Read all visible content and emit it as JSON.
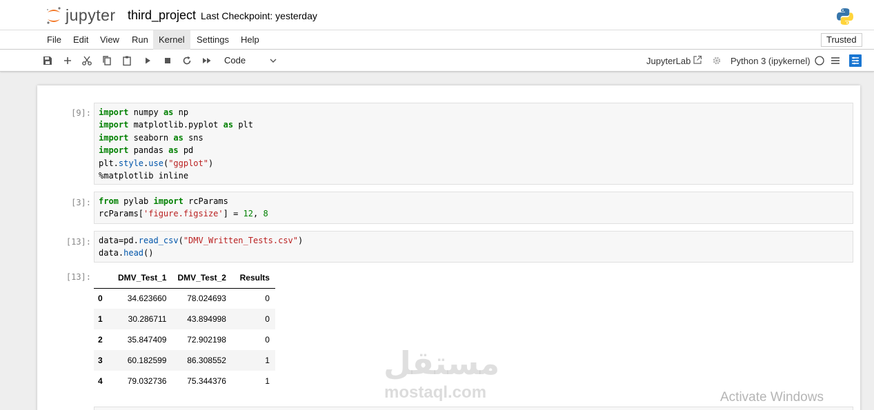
{
  "header": {
    "logo_text": "jupyter",
    "notebook_title": "third_project",
    "checkpoint": "Last Checkpoint: yesterday"
  },
  "menu": {
    "items": [
      "File",
      "Edit",
      "View",
      "Run",
      "Kernel",
      "Settings",
      "Help"
    ],
    "active": "Kernel",
    "trusted": "Trusted"
  },
  "toolbar": {
    "icons": [
      "save-icon",
      "add-cell-icon",
      "cut-icon",
      "copy-icon",
      "paste-icon",
      "run-icon",
      "stop-icon",
      "restart-icon",
      "fast-forward-icon"
    ],
    "cell_type": "Code",
    "jupyterlab_label": "JupyterLab",
    "kernel_name": "Python 3 (ipykernel)"
  },
  "cells": [
    {
      "prompt": "[9]:",
      "lines": [
        [
          [
            "k",
            "import"
          ],
          [
            "t",
            " numpy "
          ],
          [
            "k",
            "as"
          ],
          [
            "t",
            " np"
          ]
        ],
        [
          [
            "k",
            "import"
          ],
          [
            "t",
            " matplotlib.pyplot "
          ],
          [
            "k",
            "as"
          ],
          [
            "t",
            " plt"
          ]
        ],
        [
          [
            "k",
            "import"
          ],
          [
            "t",
            " seaborn "
          ],
          [
            "k",
            "as"
          ],
          [
            "t",
            " sns"
          ]
        ],
        [
          [
            "k",
            "import"
          ],
          [
            "t",
            " pandas "
          ],
          [
            "k",
            "as"
          ],
          [
            "t",
            " pd"
          ]
        ],
        [
          [
            "t",
            "plt."
          ],
          [
            "f",
            "style"
          ],
          [
            "t",
            "."
          ],
          [
            "f",
            "use"
          ],
          [
            "t",
            "("
          ],
          [
            "s",
            "\"ggplot\""
          ],
          [
            "t",
            ")"
          ]
        ],
        [
          [
            "t",
            "%matplotlib inline"
          ]
        ]
      ]
    },
    {
      "prompt": "[3]:",
      "lines": [
        [
          [
            "k",
            "from"
          ],
          [
            "t",
            " pylab "
          ],
          [
            "k",
            "import"
          ],
          [
            "t",
            " rcParams"
          ]
        ],
        [
          [
            "t",
            "rcParams["
          ],
          [
            "s",
            "'figure.figsize'"
          ],
          [
            "t",
            "] = "
          ],
          [
            "n",
            "12"
          ],
          [
            "t",
            ", "
          ],
          [
            "n",
            "8"
          ]
        ]
      ]
    },
    {
      "prompt": "[13]:",
      "lines": [
        [
          [
            "t",
            "data=pd."
          ],
          [
            "f",
            "read_csv"
          ],
          [
            "t",
            "("
          ],
          [
            "s",
            "\"DMV_Written_Tests.csv\""
          ],
          [
            "t",
            ")"
          ]
        ],
        [
          [
            "t",
            "data."
          ],
          [
            "f",
            "head"
          ],
          [
            "t",
            "()"
          ]
        ]
      ]
    }
  ],
  "output": {
    "prompt": "[13]:",
    "columns": [
      "",
      "DMV_Test_1",
      "DMV_Test_2",
      "Results"
    ],
    "rows": [
      [
        "0",
        "34.623660",
        "78.024693",
        "0"
      ],
      [
        "1",
        "30.286711",
        "43.894998",
        "0"
      ],
      [
        "2",
        "35.847409",
        "72.902198",
        "0"
      ],
      [
        "3",
        "60.182599",
        "86.308552",
        "1"
      ],
      [
        "4",
        "79.032736",
        "75.344376",
        "1"
      ]
    ]
  },
  "watermark": {
    "arabic": "مستقل",
    "latin": "mostaql.com",
    "activate": "Activate Windows"
  },
  "colors": {
    "keyword": "#008000",
    "string": "#ba2121",
    "accent": "#1976d2",
    "jupyter_orange": "#f37726"
  }
}
